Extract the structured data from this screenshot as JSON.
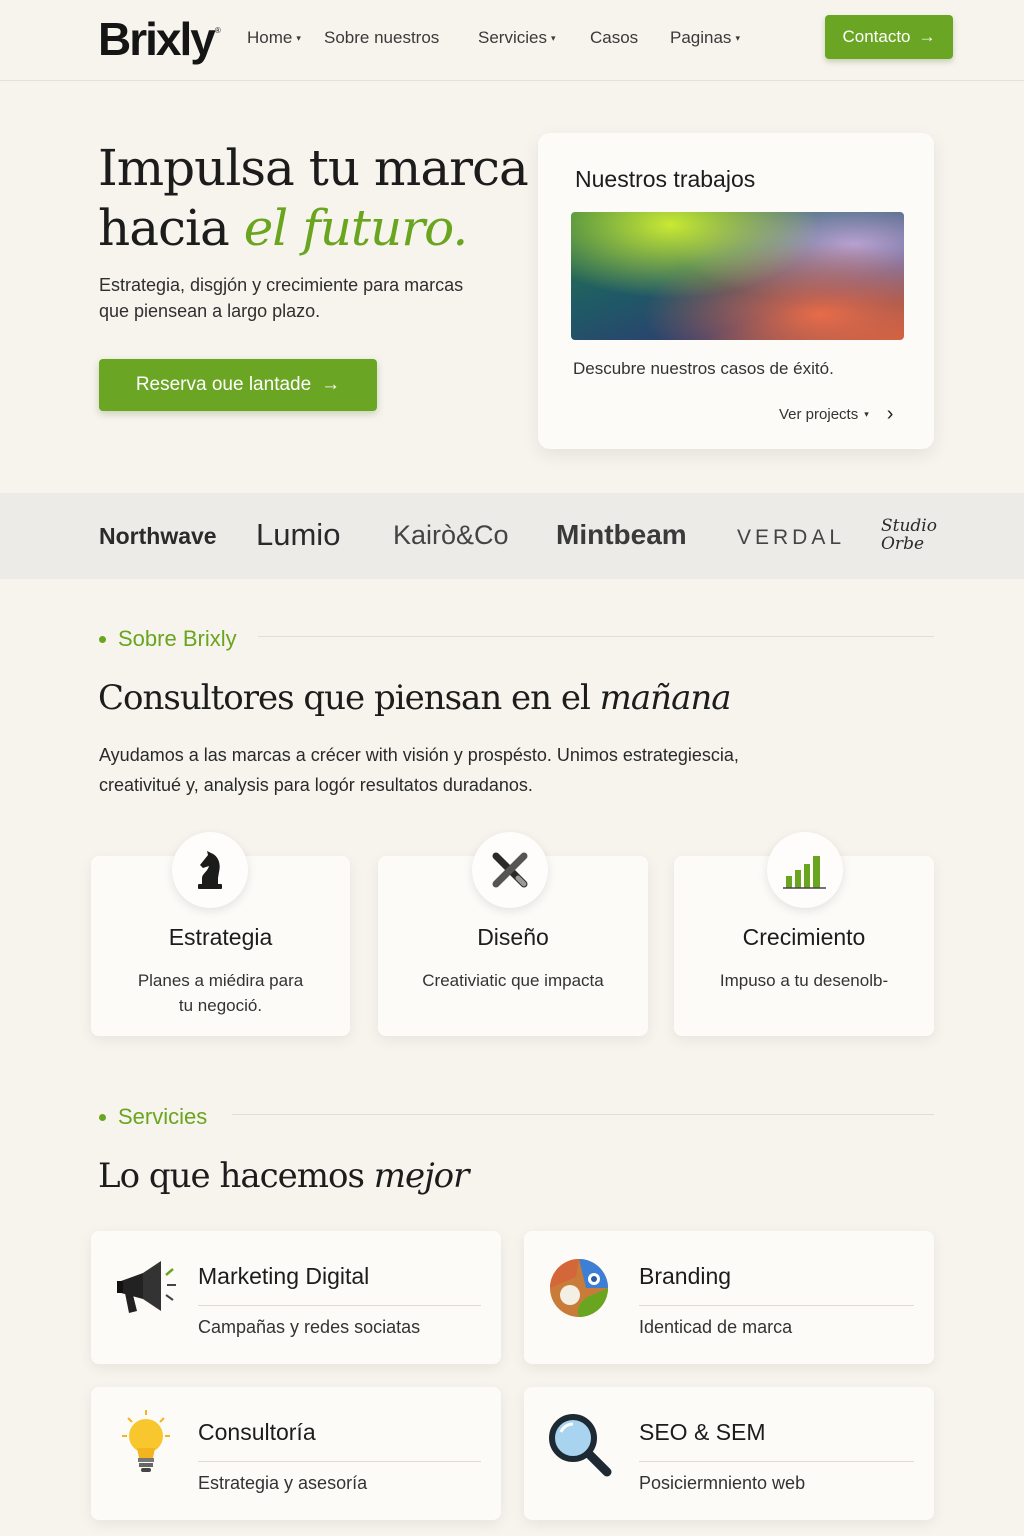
{
  "nav": {
    "logo": "Brixly",
    "logo_mark": "®",
    "items": [
      {
        "label": "Home",
        "dropdown": true
      },
      {
        "label": "Sobre nuestros",
        "dropdown": false
      },
      {
        "label": "Servicies",
        "dropdown": true
      },
      {
        "label": "Casos",
        "dropdown": false
      },
      {
        "label": "Paginas",
        "dropdown": true
      }
    ],
    "cta": "Contacto",
    "cta_icon": "arrow-right-icon"
  },
  "hero": {
    "title_line1": "Impulsa tu marca",
    "title_line2_plain": "hacia ",
    "title_line2_em": "el futuro.",
    "subtitle": "Estrategia, disgjón y crecimiente para marcas que piensean a largo plazo.",
    "button": "Reserva oue lantade",
    "button_icon": "arrow-right-icon"
  },
  "work_card": {
    "title": "Nuestros trabajos",
    "description": "Descubre nuestros casos de éxitó.",
    "link": "Ver projects",
    "link_icon": "chevron-right-icon"
  },
  "brands": [
    "Northwave",
    "Lumio",
    "Kairò&Co",
    "Mintbeam",
    "VERDAL",
    "Studio Orbe"
  ],
  "about": {
    "label": "Sobre Brixly",
    "heading_plain": "Consultores que piensan en el ",
    "heading_em": "mañana",
    "text": "Ayudamos a las marcas a crécer with visión y prospésto. Unimos estrategiescia, creativitué y, analysis para logór resultatos duradanos."
  },
  "features": [
    {
      "icon": "chess-knight-icon",
      "title": "Estrategia",
      "desc": "Planes a miédira para tu negoció."
    },
    {
      "icon": "pencil-cross-icon",
      "title": "Diseño",
      "desc": "Creativiatic que impacta"
    },
    {
      "icon": "bar-chart-icon",
      "title": "Crecimiento",
      "desc": "Impuso a tu desenolb-"
    }
  ],
  "services": {
    "label": "Servicies",
    "heading_plain": "Lo que hacemos ",
    "heading_em": "mejor",
    "items": [
      {
        "icon": "megaphone-icon",
        "title": "Marketing Digital",
        "desc": "Campañas y redes sociatas"
      },
      {
        "icon": "palette-icon",
        "title": "Branding",
        "desc": "Identicad de marca"
      },
      {
        "icon": "lightbulb-icon",
        "title": "Consultoría",
        "desc": "Estrategia y asesoría"
      },
      {
        "icon": "magnifier-icon",
        "title": "SEO & SEM",
        "desc": "Posiciermniento web"
      }
    ]
  },
  "colors": {
    "accent": "#6ba524",
    "background": "#f7f4ee",
    "card": "#fcfbf8"
  }
}
